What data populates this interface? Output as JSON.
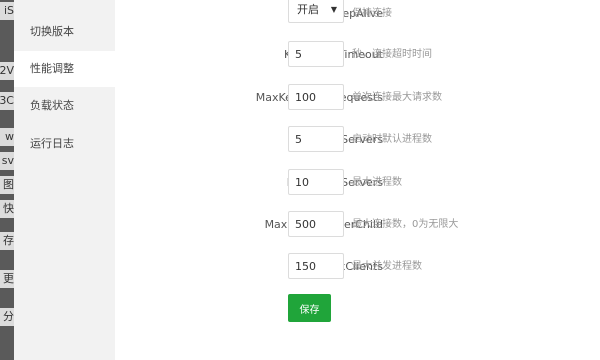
{
  "left_strip": {
    "fragments": [
      "iS",
      "2V",
      "3C",
      "w",
      "sv",
      "图",
      "快",
      "存",
      "更",
      "分"
    ]
  },
  "sidebar": {
    "items": [
      {
        "label": "切换版本",
        "active": false
      },
      {
        "label": "性能调整",
        "active": true
      },
      {
        "label": "负载状态",
        "active": false
      },
      {
        "label": "运行日志",
        "active": false
      }
    ]
  },
  "form": {
    "fields": [
      {
        "label": "KeepAlive",
        "type": "select",
        "value": "开启",
        "hint": "保持连接"
      },
      {
        "label": "KeepAliveTimeout",
        "type": "input",
        "value": "5",
        "hint": "秒，连接超时时间"
      },
      {
        "label": "MaxKeepAliveRequests",
        "type": "input",
        "value": "100",
        "hint": "单次连接最大请求数"
      },
      {
        "label": "StartServers",
        "type": "input",
        "value": "5",
        "hint": "启动时默认进程数"
      },
      {
        "label": "MaxSpareServers",
        "type": "input",
        "value": "10",
        "hint": "最大进程数"
      },
      {
        "label": "MaxRequestsPerChild",
        "type": "input",
        "value": "500",
        "hint": "最大连接数，0为无限大"
      },
      {
        "label": "MaxClients",
        "type": "input",
        "value": "150",
        "hint": "最大并发进程数"
      }
    ],
    "save_label": "保存"
  },
  "colors": {
    "accent": "#20a53a",
    "sidebar_bg": "#f2f2f2",
    "left_strip_bg": "#5a5a5a"
  }
}
